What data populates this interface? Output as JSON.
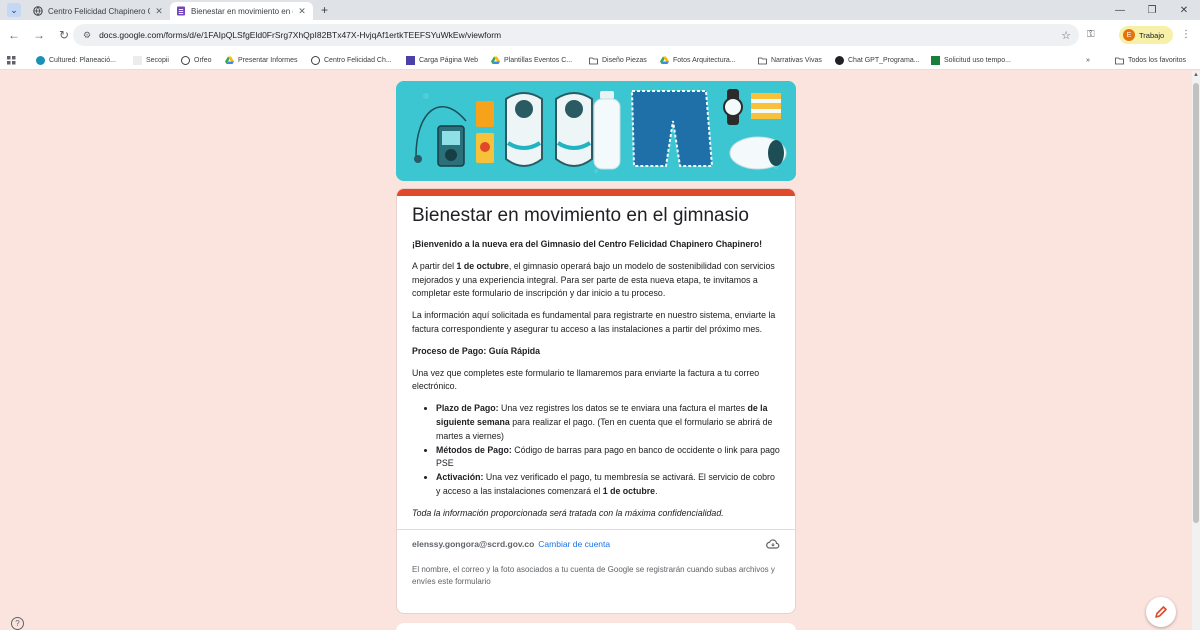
{
  "browser": {
    "tabs": [
      {
        "title": "Centro Felicidad Chapinero CEF",
        "active": false
      },
      {
        "title": "Bienestar en movimiento en el g",
        "active": true
      }
    ],
    "url": "docs.google.com/forms/d/e/1FAIpQLSfgEld0FrSrg7XhQpI82BTx47X-HvjqAf1ertkTEEFSYuWkEw/viewform",
    "profile_label": "Trabajo",
    "profile_initial": "E",
    "bookmarks": [
      "Cultured: Planeació...",
      "Secopii",
      "Orfeo",
      "Presentar Informes",
      "Centro Felicidad Ch...",
      "Carga Página Web",
      "Plantillas Eventos C...",
      "Diseño Piezas",
      "Fotos Arquitectura...",
      "Narrativas Vivas",
      "Chat GPT_Programa...",
      "Solicitud uso tempo...",
      "Todos los favoritos"
    ],
    "colors": {
      "accent": "#e0492a",
      "page_bg": "#fce4de",
      "header_bg": "#3bc6d2"
    }
  },
  "form": {
    "title": "Bienestar en movimiento en el gimnasio",
    "welcome": "¡Bienvenido a la nueva era del Gimnasio del Centro Felicidad Chapinero Chapinero!",
    "p1_a": "A partir del ",
    "p1_b": "1 de octubre",
    "p1_c": ", el gimnasio operará bajo un modelo de sostenibilidad con servicios mejorados y una experiencia integral. Para ser parte de esta nueva etapa, te invitamos a completar este formulario de inscripción y dar inicio a tu proceso.",
    "p2": "La información aquí solicitada es fundamental para registrarte en nuestro sistema, enviarte la factura correspondiente y asegurar tu acceso a las instalaciones a partir del próximo mes.",
    "pay_heading": "Proceso de Pago: Guía Rápida",
    "p3": "Una vez que completes este formulario te llamaremos para enviarte la factura a tu correo electrónico.",
    "bullets": [
      {
        "label": "Plazo de Pago:",
        "text": " Una vez registres los datos se te enviara una factura el martes ",
        "bold2": " de la siguiente semana",
        "text2": " para realizar el pago. (Ten en cuenta que el formulario se abrirá de martes a viernes)"
      },
      {
        "label": "Métodos de Pago:",
        "text": " Código de barras para pago en banco de occidente o link para pago PSE",
        "bold2": "",
        "text2": ""
      },
      {
        "label": "Activación:",
        "text": " Una vez verificado el pago, tu membresía se activará. El servicio de cobro y acceso a las instalaciones comenzará el ",
        "bold2": "1 de octubre",
        "text2": "."
      }
    ],
    "privacy": "Toda la información proporcionada será tratada con la máxima confidencialidad.",
    "email": "elenssy.gongora@scrd.gov.co",
    "switch_account": "Cambiar de cuenta",
    "account_note": "El nombre, el correo y la foto asociados a tu cuenta de Google se registrarán cuando subas archivos y envíes este formulario"
  },
  "icons": [
    "tab-search-icon",
    "close-icon",
    "new-tab-icon",
    "minimize-icon",
    "restore-icon",
    "window-close-icon",
    "back-icon",
    "forward-icon",
    "reload-icon",
    "site-info-icon",
    "star-icon",
    "key-icon",
    "menu-icon",
    "apps-icon",
    "folder-icon",
    "cloud-icon",
    "edit-pencil-icon",
    "help-icon"
  ]
}
